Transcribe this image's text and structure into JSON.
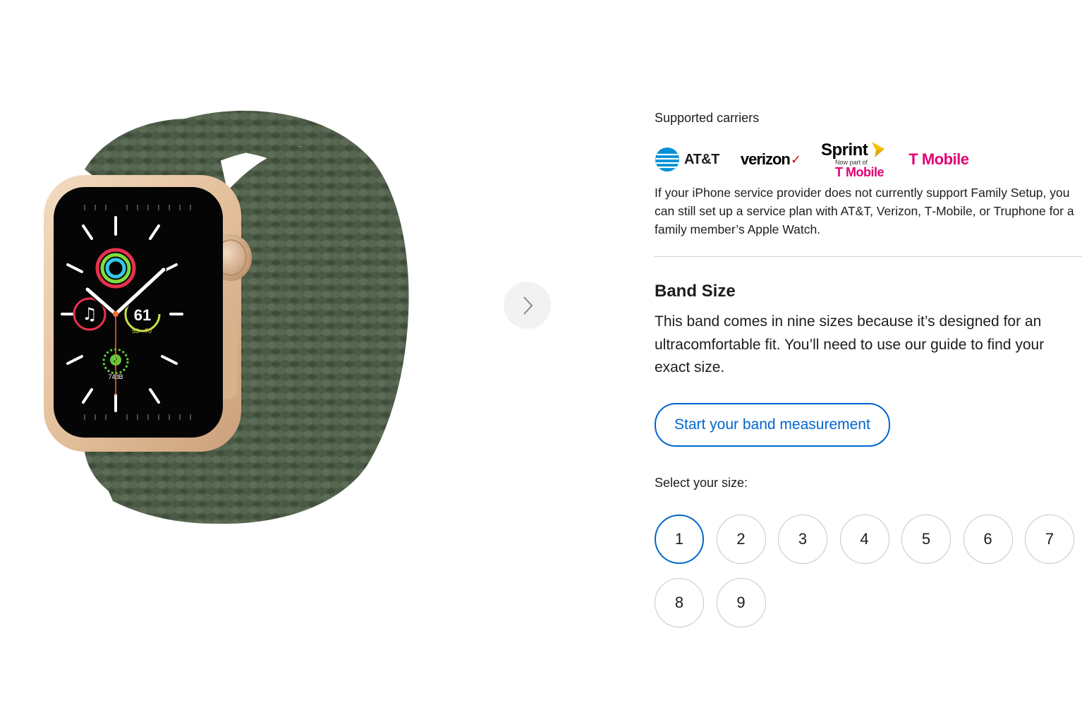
{
  "carriers": {
    "label": "Supported carriers",
    "logos": {
      "att": "AT&T",
      "verizon": "verizon",
      "sprint": "Sprint",
      "sprint_sub": "Now part of",
      "sprint_tmobile": "T Mobile",
      "tmobile": "T Mobile"
    },
    "note": "If your iPhone service provider does not currently support Family Setup, you can still set up a service plan with AT&T, Verizon, T‑Mobile, or Truphone for a family member’s Apple Watch."
  },
  "band_size": {
    "heading": "Band Size",
    "description": "This band comes in nine sizes because it’s designed for an ultracomfortable fit. You’ll need to use our guide to find your exact size.",
    "measure_button": "Start your band measurement",
    "select_label": "Select your size:",
    "sizes": [
      "1",
      "2",
      "3",
      "4",
      "5",
      "6",
      "7",
      "8",
      "9"
    ],
    "selected": "1"
  },
  "watch_face": {
    "complication_right": "61",
    "complication_right_low": "53",
    "complication_right_high": "70",
    "noise": "74dB"
  },
  "colors": {
    "accent": "#0066cc",
    "band": "#4a5a45",
    "case": "#e8c9a8",
    "tmobile": "#e20074",
    "verizon_check": "#cd040b",
    "att_blue": "#0091d6"
  },
  "icons": {
    "next": "chevron-right-icon",
    "music": "music-note-icon",
    "noise": "noise-check-icon"
  }
}
